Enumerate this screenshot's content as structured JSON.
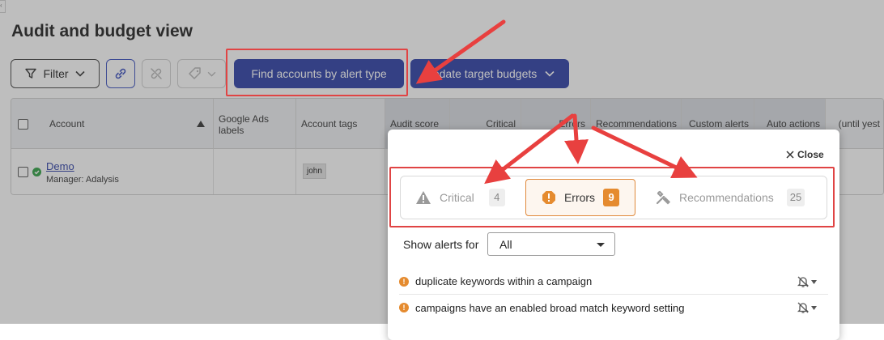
{
  "page": {
    "title": "Audit and budget view"
  },
  "toolbar": {
    "filter_label": "Filter",
    "find_accounts_label": "Find accounts by alert type",
    "update_budgets_label": "Update target budgets"
  },
  "table": {
    "headers": {
      "account": "Account",
      "gads_labels": "Google Ads labels",
      "account_tags": "Account tags",
      "audit_score": "Audit score",
      "critical": "Critical",
      "errors": "Errors",
      "recommendations": "Recommendations",
      "custom_alerts": "Custom alerts",
      "auto_actions": "Auto actions",
      "until_yesterday": "(until yest"
    },
    "rows": [
      {
        "account_name": "Demo",
        "manager": "Manager: Adalysis",
        "tag": "john"
      }
    ]
  },
  "popup": {
    "close_label": "Close",
    "segments": {
      "critical": {
        "label": "Critical",
        "count": "4"
      },
      "errors": {
        "label": "Errors",
        "count": "9"
      },
      "recommendations": {
        "label": "Recommendations",
        "count": "25"
      }
    },
    "show_alerts_label": "Show alerts for",
    "show_alerts_value": "All",
    "alerts": [
      {
        "text": "duplicate keywords within a campaign"
      },
      {
        "text": "campaigns have an enabled broad match keyword setting"
      }
    ]
  },
  "colors": {
    "primary_button": "#2b3ea6",
    "error_orange": "#e58b2f",
    "annotation_red": "#e04444"
  }
}
